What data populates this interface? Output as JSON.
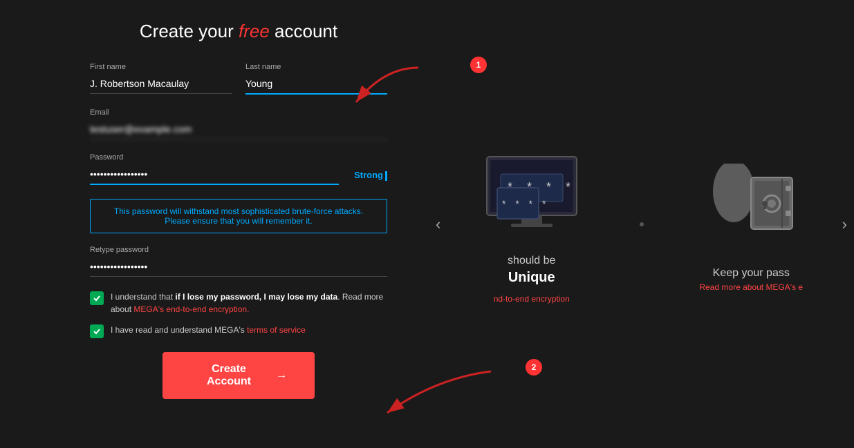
{
  "page": {
    "title_prefix": "Create your ",
    "title_highlight": "free",
    "title_suffix": " account"
  },
  "form": {
    "first_name_label": "First name",
    "first_name_value": "J. Robertson Macaulay",
    "last_name_label": "Last name",
    "last_name_value": "Young",
    "email_label": "Email",
    "email_placeholder": "••••••••••••••••••",
    "password_label": "Password",
    "password_value": "••••••••••••••",
    "password_strength": "Strong",
    "password_info": "This password will withstand most sophisticated brute-force attacks. Please ensure that you will remember it.",
    "retype_label": "Retype password",
    "retype_value": "••••••••••••",
    "checkbox1_text": "I understand that ",
    "checkbox1_bold": "if I lose my password, I may lose my data",
    "checkbox1_suffix": ". Read more about ",
    "checkbox1_link": "MEGA's end-to-end encryption.",
    "checkbox2_prefix": "I have read and understand MEGA's ",
    "checkbox2_link": "terms of service",
    "create_btn": "Create Account",
    "create_btn_arrow": "→"
  },
  "carousel": {
    "slide1": {
      "text_main": " should be",
      "text_bold": "Unique",
      "link": "nd-to-end encryption"
    },
    "slide2": {
      "text_main": "Keep your pass",
      "link": "Read more about MEGA's e"
    },
    "nav_left": "‹",
    "nav_right": "›"
  },
  "annotations": {
    "marker1": "1",
    "marker2": "2"
  }
}
